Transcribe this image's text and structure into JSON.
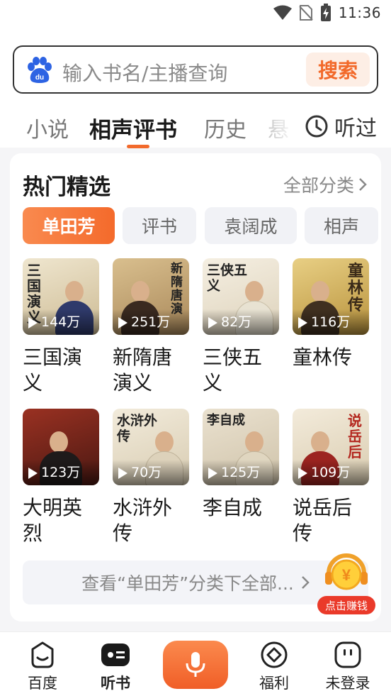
{
  "status_bar": {
    "time": "11:36"
  },
  "search": {
    "placeholder": "输入书名/主播查询",
    "button_label": "搜索",
    "logo_icon": "baidu-paw-icon"
  },
  "tabs": [
    {
      "label": "小说",
      "active": false
    },
    {
      "label": "相声评书",
      "active": true
    },
    {
      "label": "历史",
      "active": false
    },
    {
      "label": "悬",
      "active": false
    }
  ],
  "history": {
    "label": "听过",
    "icon": "clock-icon"
  },
  "section": {
    "title": "热门精选",
    "all_categories": "全部分类",
    "chips": [
      {
        "label": "单田芳",
        "active": true
      },
      {
        "label": "评书",
        "active": false
      },
      {
        "label": "袁阔成",
        "active": false
      },
      {
        "label": "相声",
        "active": false
      }
    ],
    "books": [
      {
        "title": "三国演义",
        "plays": "144万",
        "cover_text": "三国演义",
        "cover_color": "#e7dcc2",
        "cover_accent": "#2f3a6b"
      },
      {
        "title": "新隋唐演义",
        "plays": "251万",
        "cover_text": "新隋唐演",
        "cover_color": "#c9a877",
        "cover_accent": "#3a2a20"
      },
      {
        "title": "三侠五义",
        "plays": "82万",
        "cover_text": "三侠五义",
        "cover_color": "#efe7d6",
        "cover_accent": "#e6e0cc"
      },
      {
        "title": "童林传",
        "plays": "116万",
        "cover_text": "童林传",
        "cover_color": "#d6b55f",
        "cover_accent": "#403020"
      },
      {
        "title": "大明英烈",
        "plays": "123万",
        "cover_text": "",
        "cover_color": "#8e2a1e",
        "cover_accent": "#1e1a1a"
      },
      {
        "title": "水浒外传",
        "plays": "70万",
        "cover_text": "水浒外传",
        "cover_color": "#ece4d2",
        "cover_accent": "#d8cdb6"
      },
      {
        "title": "李自成",
        "plays": "125万",
        "cover_text": "李自成",
        "cover_color": "#e3d9c6",
        "cover_accent": "#d9cfb9"
      },
      {
        "title": "说岳后传",
        "plays": "109万",
        "cover_text": "说岳后",
        "cover_color": "#efe6d4",
        "cover_accent": "#9c2420"
      }
    ],
    "view_all": "查看“单田芳”分类下全部..."
  },
  "earn_badge": {
    "label": "点击赚钱",
    "icon": "coin-headphones-icon",
    "symbol": "¥"
  },
  "bottom_nav": [
    {
      "label": "百度",
      "icon": "baidu-face-icon",
      "active": false
    },
    {
      "label": "听书",
      "icon": "audiobook-icon",
      "active": true
    },
    {
      "label": "",
      "icon": "microphone-icon",
      "active": false
    },
    {
      "label": "福利",
      "icon": "welfare-icon",
      "active": false
    },
    {
      "label": "未登录",
      "icon": "user-icon",
      "active": false
    }
  ]
}
